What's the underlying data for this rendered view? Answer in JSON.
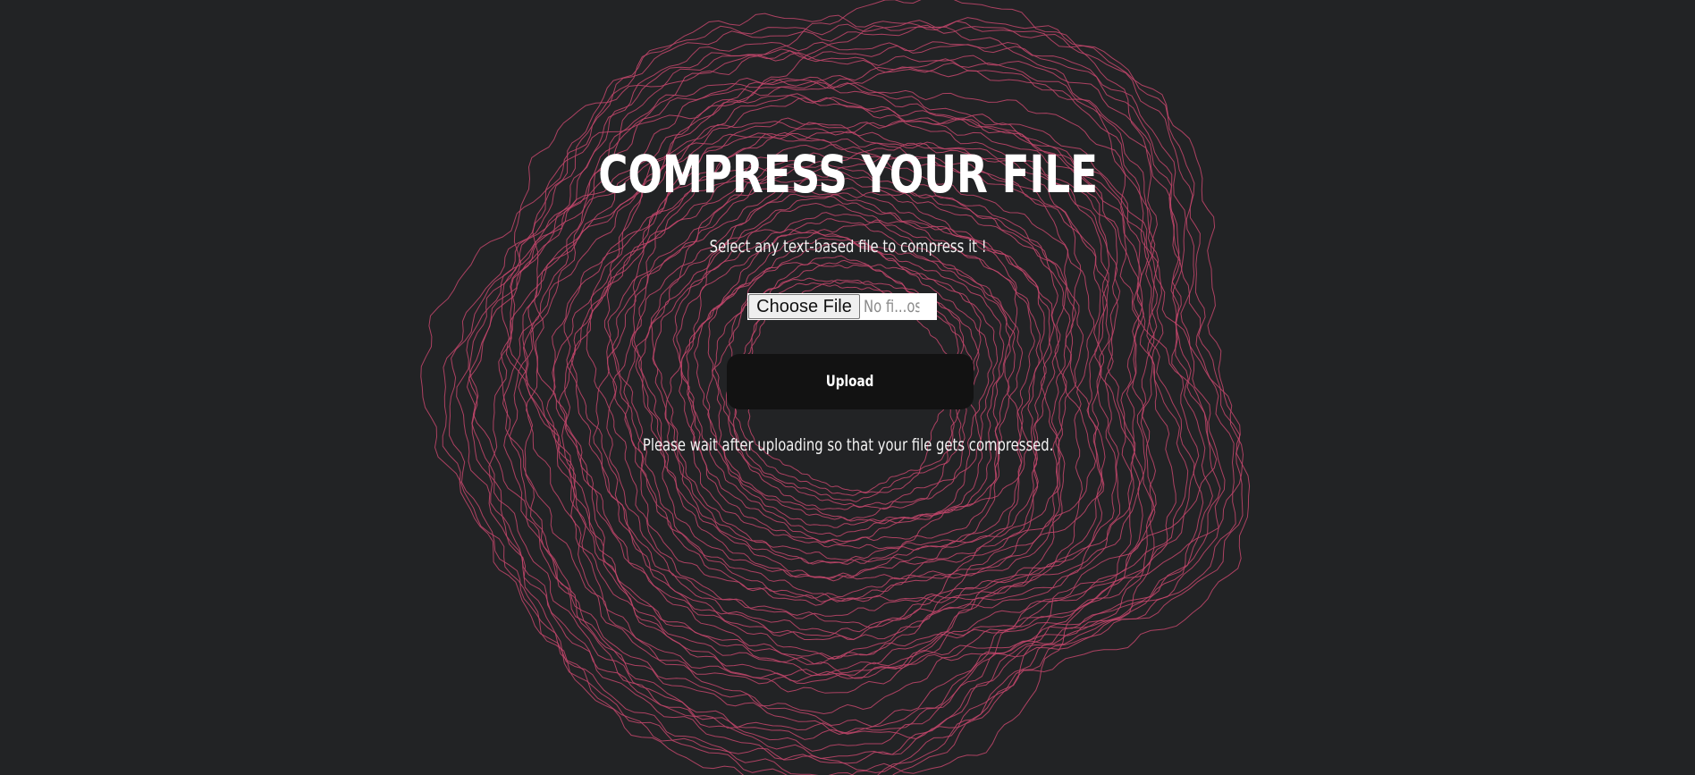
{
  "page": {
    "title": "COMPRESS YOUR FILE",
    "subtitle": "Select any text-based file to compress it !",
    "note": "Please wait after uploading so that your file gets compressed."
  },
  "file_input": {
    "button_label": "Choose File",
    "status_text": "No fi...osen"
  },
  "upload_button": {
    "label": "Upload"
  },
  "theme": {
    "background": "#222325",
    "line_color": "#c4476c",
    "button_color": "#121212"
  }
}
